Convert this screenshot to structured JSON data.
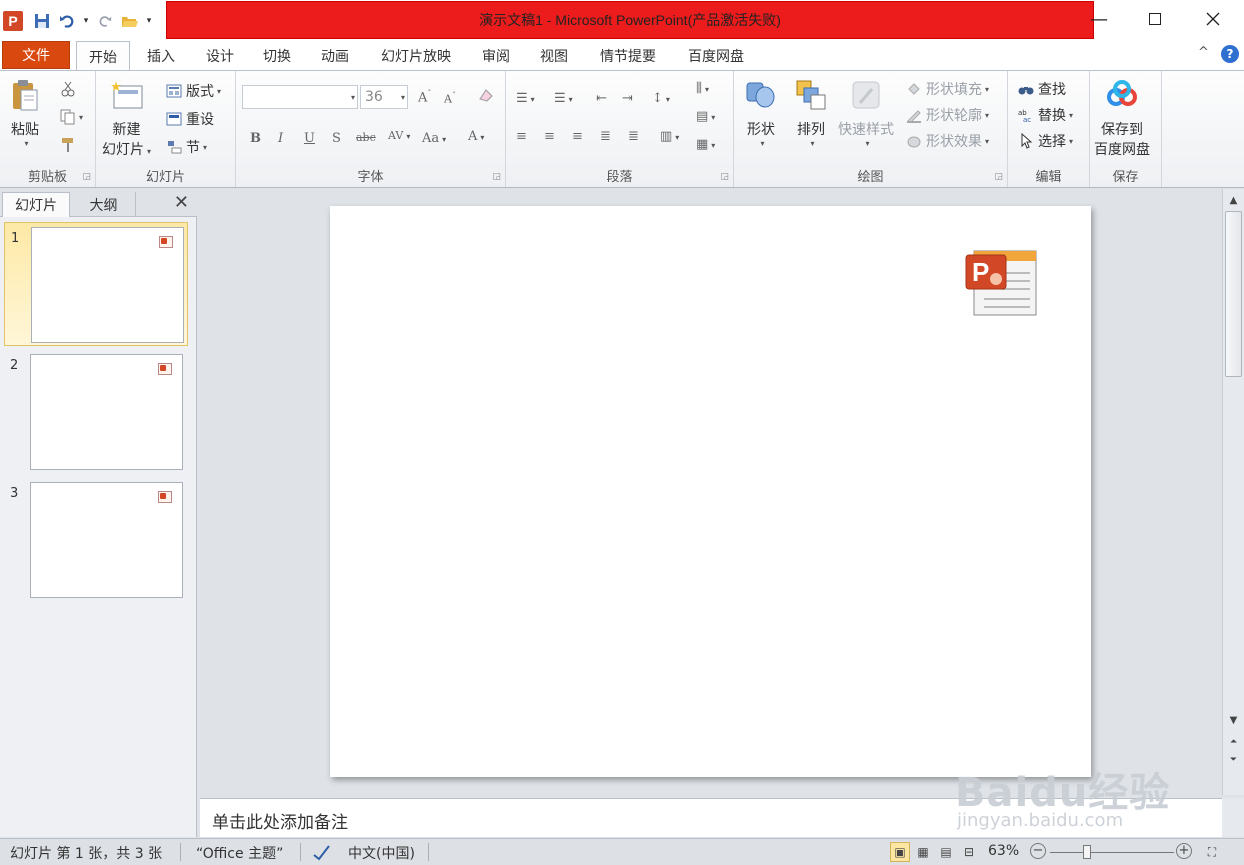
{
  "window": {
    "title": "演示文稿1 - Microsoft PowerPoint(产品激活失败)",
    "title_bar_color": "#ec1c1c",
    "app_icon": "powerpoint-icon",
    "app_icon_letter": "P"
  },
  "quick_access": {
    "items": [
      "save-icon",
      "undo-icon",
      "redo-icon",
      "open-icon",
      "customize-icon"
    ]
  },
  "tabs": {
    "file": "文件",
    "items": [
      "开始",
      "插入",
      "设计",
      "切换",
      "动画",
      "幻灯片放映",
      "审阅",
      "视图",
      "情节提要",
      "百度网盘"
    ],
    "active": "开始",
    "file_color": "#d9480e"
  },
  "ribbon": {
    "clipboard": {
      "label": "剪贴板",
      "paste": "粘贴"
    },
    "slides": {
      "label": "幻灯片",
      "new_slide_line1": "新建",
      "new_slide_line2": "幻灯片",
      "layout": "版式",
      "reset": "重设",
      "section": "节"
    },
    "font": {
      "label": "字体",
      "font_name": "",
      "font_size": "36"
    },
    "paragraph": {
      "label": "段落"
    },
    "drawing": {
      "label": "绘图",
      "shapes": "形状",
      "arrange": "排列",
      "quick_styles": "快速样式",
      "fill": "形状填充",
      "outline": "形状轮廓",
      "effects": "形状效果"
    },
    "editing": {
      "label": "编辑",
      "find": "查找",
      "replace": "替换",
      "select": "选择"
    },
    "save": {
      "label": "保存",
      "line1": "保存到",
      "line2": "百度网盘"
    }
  },
  "left_pane": {
    "tab_slides": "幻灯片",
    "tab_outline": "大纲",
    "slides": [
      {
        "num": "1",
        "selected": true
      },
      {
        "num": "2",
        "selected": false
      },
      {
        "num": "3",
        "selected": false
      }
    ]
  },
  "notes": {
    "placeholder": "单击此处添加备注"
  },
  "status_bar": {
    "slide_info": "幻灯片 第 1 张，共 3 张",
    "theme": "“Office 主题”",
    "language": "中文(中国)",
    "zoom": "63%",
    "zoom_value": 0.63
  },
  "watermark": {
    "brand": "Baidu经验",
    "url": "jingyan.baidu.com"
  }
}
